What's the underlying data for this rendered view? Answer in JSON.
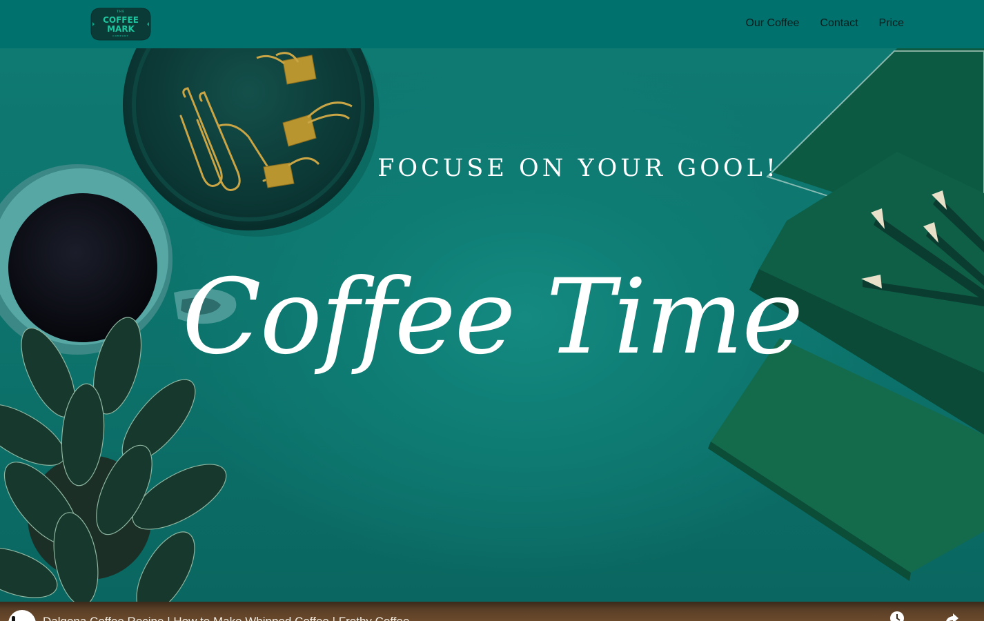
{
  "nav": {
    "logo": {
      "top": "THE",
      "line1": "COFFEE",
      "line2": "MARK",
      "bottom": "COMPANY"
    },
    "links": [
      {
        "label": "Our Coffee"
      },
      {
        "label": "Contact"
      },
      {
        "label": "Price"
      }
    ]
  },
  "hero": {
    "tagline": "FOCUSE ON YOUR GOOL!",
    "title": "Coffee Time"
  },
  "video": {
    "title": "Dalgona Coffee Recipe | How to Make Whipped Coffee | Frothy Coffee",
    "icons": [
      "watch-later-icon",
      "share-icon"
    ]
  },
  "colors": {
    "navbar": "#00716d",
    "hero_bg": "#0f7a72",
    "text_light": "#ffffff",
    "nav_text": "#0b1d1c",
    "video_bar": "#5a3f27"
  }
}
